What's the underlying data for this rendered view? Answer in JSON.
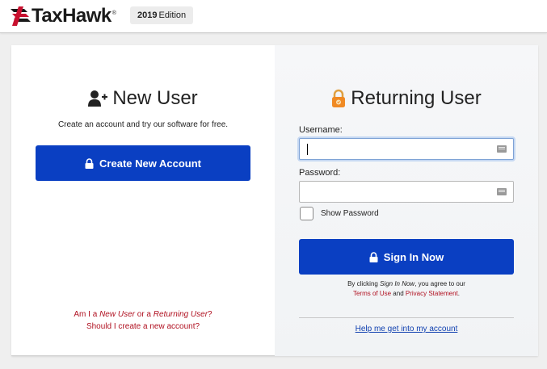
{
  "header": {
    "brand": "TaxHawk",
    "registered": "®",
    "edition_year": "2019",
    "edition_label": "Edition"
  },
  "new_user": {
    "title": "New User",
    "subtitle": "Create an account and try our software for free.",
    "create_button": "Create New Account",
    "question_prefix": "Am I a ",
    "question_new": "New User",
    "question_middle": " or a ",
    "question_returning": "Returning User",
    "question_suffix": "?",
    "question_line2": "Should I create a new account?"
  },
  "returning_user": {
    "title": "Returning User",
    "username_label": "Username:",
    "username_value": "",
    "password_label": "Password:",
    "password_value": "",
    "show_password_label": "Show Password",
    "show_password_checked": false,
    "signin_button": "Sign In Now",
    "terms_prefix": "By clicking ",
    "terms_action": "Sign In Now",
    "terms_suffix": ", you agree to our",
    "terms_of_use": "Terms of Use",
    "terms_and": " and ",
    "privacy": "Privacy Statement",
    "terms_end": ".",
    "help_link": "Help me get into my account"
  },
  "colors": {
    "primary_button": "#0a3fc2",
    "link_red": "#b01020",
    "link_blue": "#1040b0",
    "lock_orange": "#f08a24"
  },
  "icons": {
    "brand_logo": "taxhawk-logo-icon",
    "new_user": "user-plus-icon",
    "returning_user": "padlock-icon",
    "button_lock": "lock-icon",
    "field_autofill": "keyboard-icon"
  }
}
